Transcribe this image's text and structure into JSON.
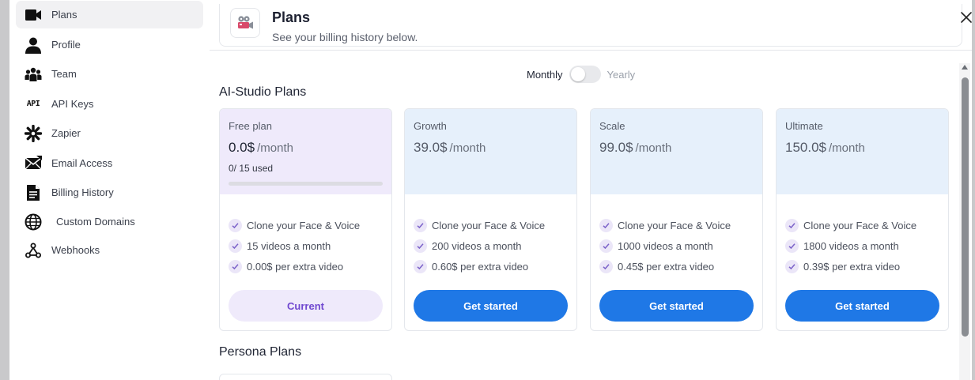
{
  "sidebar": {
    "items": [
      {
        "label": "Plans",
        "icon": "video-camera-icon",
        "active": true
      },
      {
        "label": "Profile",
        "icon": "user-icon"
      },
      {
        "label": "Team",
        "icon": "team-icon"
      },
      {
        "label": "API Keys",
        "icon": "api-icon"
      },
      {
        "label": "Zapier",
        "icon": "zapier-icon"
      },
      {
        "label": "Email Access",
        "icon": "email-icon"
      },
      {
        "label": "Billing History",
        "icon": "document-icon"
      },
      {
        "label": "Custom Domains",
        "icon": "globe-icon"
      },
      {
        "label": "Webhooks",
        "icon": "webhook-icon"
      }
    ],
    "api_icon_text": "API"
  },
  "header": {
    "title": "Plans",
    "subtitle": "See your billing history below.",
    "badge_icon": "film-projector-icon",
    "close_icon": "close-icon"
  },
  "billing_toggle": {
    "monthly_label": "Monthly",
    "yearly_label": "Yearly",
    "selected": "Monthly"
  },
  "sections": {
    "ai_studio": "AI-Studio Plans",
    "persona": "Persona Plans"
  },
  "plans": [
    {
      "name": "Free plan",
      "price": "0.0$",
      "period": "/month",
      "usage": "0/ 15 used",
      "usage_fraction": 0,
      "features": [
        "Clone your Face & Voice",
        "15 videos a month",
        "0.00$ per extra video"
      ],
      "cta": "Current"
    },
    {
      "name": "Growth",
      "price": "39.0$",
      "period": "/month",
      "features": [
        "Clone your Face & Voice",
        "200 videos a month",
        "0.60$ per extra video"
      ],
      "cta": "Get started"
    },
    {
      "name": "Scale",
      "price": "99.0$",
      "period": "/month",
      "features": [
        "Clone your Face & Voice",
        "1000 videos a month",
        "0.45$ per extra video"
      ],
      "cta": "Get started"
    },
    {
      "name": "Ultimate",
      "price": "150.0$",
      "period": "/month",
      "features": [
        "Clone your Face & Voice",
        "1800 videos a month",
        "0.39$ per extra video"
      ],
      "cta": "Get started"
    }
  ],
  "colors": {
    "accent_blue": "#1f78e6",
    "accent_purple": "#7048d0",
    "free_card_bg": "#efeafb",
    "paid_card_bg": "#e6f0fb"
  }
}
